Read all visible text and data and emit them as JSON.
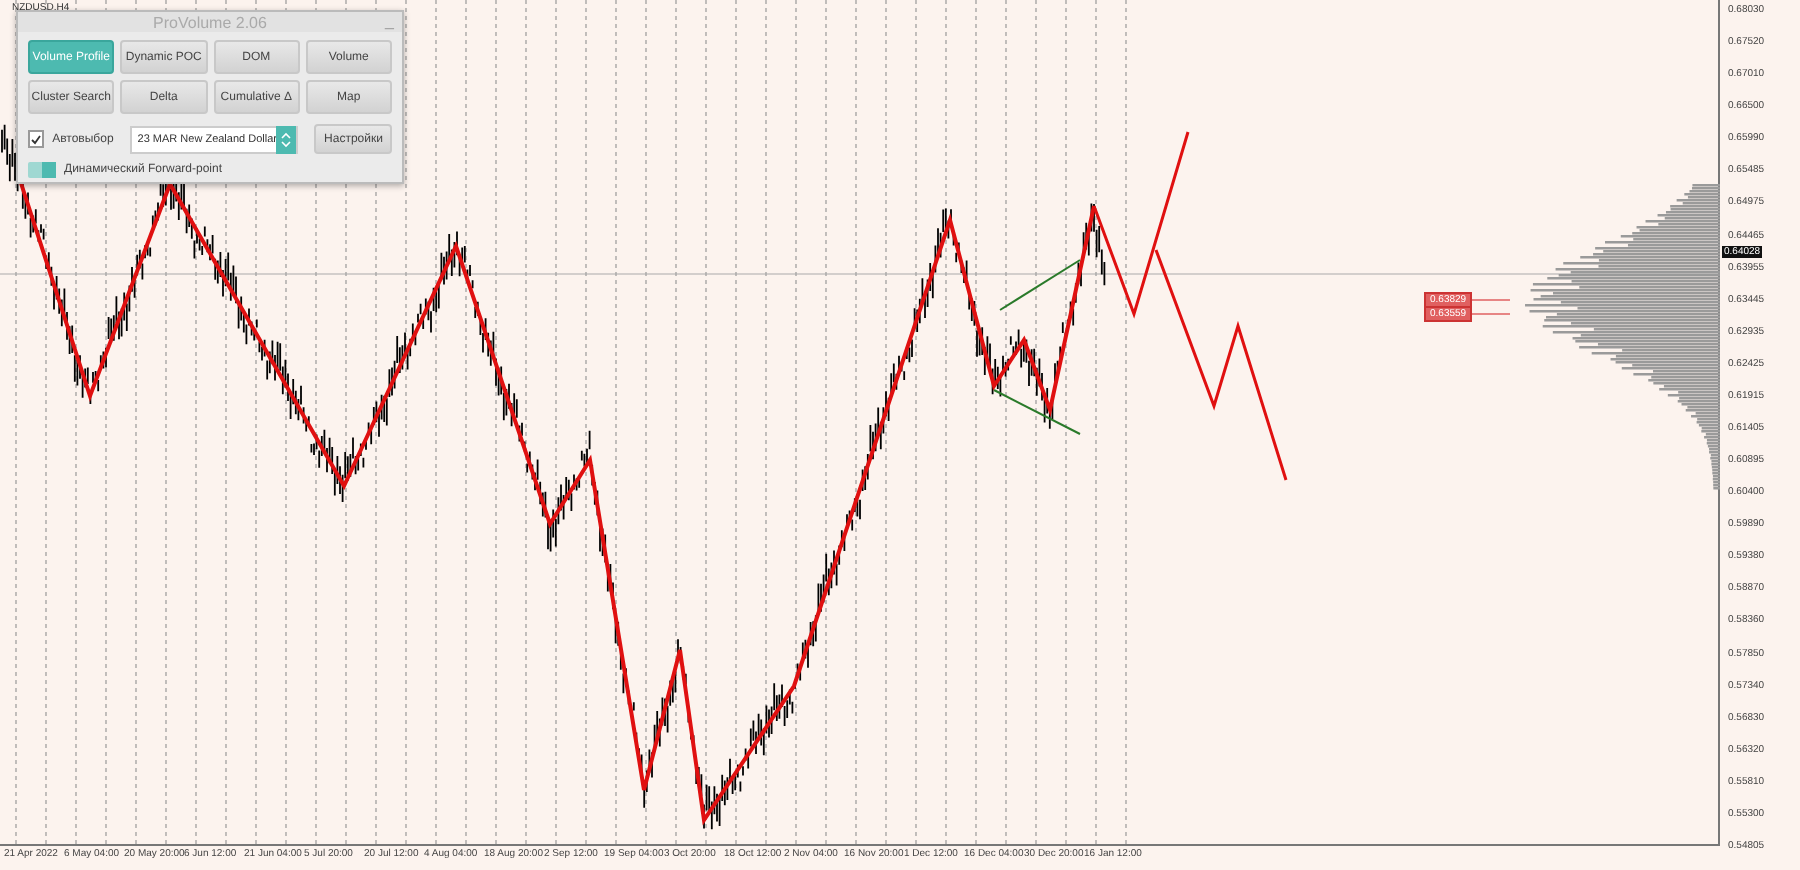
{
  "chart": {
    "symbol": "NZDUSD,H4"
  },
  "panel": {
    "title": "ProVolume 2.06",
    "minimize": "_",
    "buttons": [
      {
        "label": "Volume Profile",
        "selected": true
      },
      {
        "label": "Dynamic POC",
        "selected": false
      },
      {
        "label": "DOM",
        "selected": false
      },
      {
        "label": "Volume",
        "selected": false
      },
      {
        "label": "Cluster Search",
        "selected": false
      },
      {
        "label": "Delta",
        "selected": false
      },
      {
        "label": "Cumulative Δ",
        "selected": false
      },
      {
        "label": "Map",
        "selected": false
      }
    ],
    "auto_select": {
      "label": "Автовыбор",
      "checked": true
    },
    "instrument": {
      "value": "23 MAR New Zealand Dollar"
    },
    "settings_button": "Настройки",
    "forward_point": {
      "label": "Динамический Forward-point",
      "on": true
    }
  },
  "level_labels": [
    "0.63829",
    "0.63559"
  ],
  "price_axis": {
    "labels": [
      "0.68030",
      "0.67520",
      "0.67010",
      "0.66500",
      "0.65990",
      "0.65485",
      "0.64975",
      "0.64465",
      "0.63955",
      "0.63445",
      "0.62935",
      "0.62425",
      "0.61915",
      "0.61405",
      "0.60895",
      "0.60400",
      "0.59890",
      "0.59380",
      "0.58870",
      "0.58360",
      "0.57850",
      "0.57340",
      "0.56830",
      "0.56320",
      "0.55810",
      "0.55300",
      "0.54805"
    ],
    "current_price": "0.64028"
  },
  "time_axis": {
    "labels": [
      "21 Apr 2022",
      "6 May 04:00",
      "20 May 20:00",
      "6 Jun 12:00",
      "21 Jun 04:00",
      "5 Jul 20:00",
      "20 Jul 12:00",
      "4 Aug 04:00",
      "18 Aug 20:00",
      "2 Sep 12:00",
      "19 Sep 04:00",
      "3 Oct 20:00",
      "18 Oct 12:00",
      "2 Nov 04:00",
      "16 Nov 20:00",
      "1 Dec 12:00",
      "16 Dec 04:00",
      "30 Dec 20:00",
      "16 Jan 12:00"
    ]
  }
}
